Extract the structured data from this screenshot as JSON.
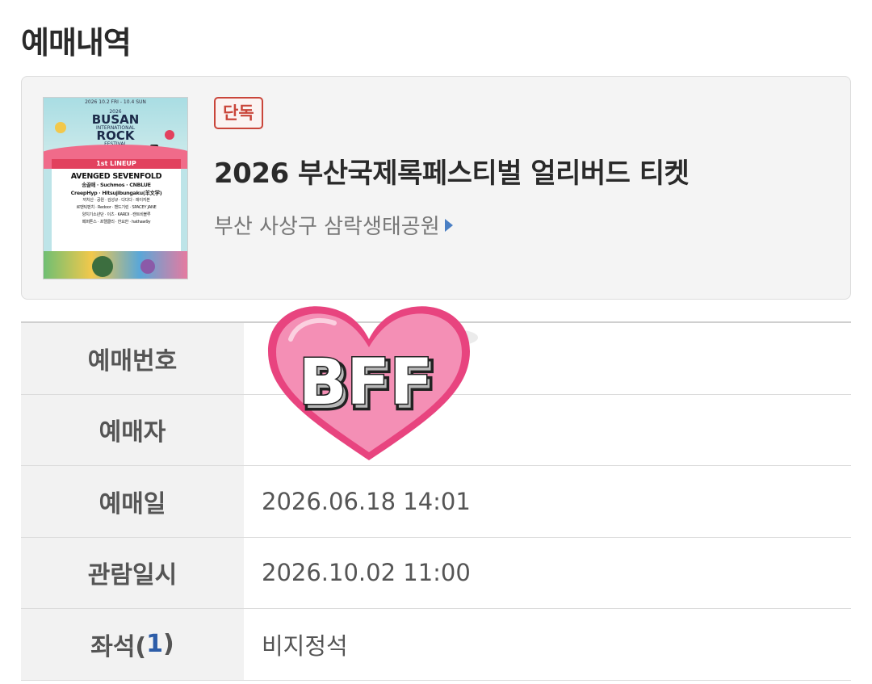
{
  "header": {
    "title": "예매내역"
  },
  "ticket": {
    "badge": "단독",
    "title": "2026 부산국제록페스티벌 얼리버드 티켓",
    "venue": "부산 사상구 삼락생태공원",
    "poster": {
      "date_line": "2026 10.2 FRI - 10.4 SUN",
      "festival_line1": "2026",
      "festival_line2": "BUSAN",
      "festival_line3": "INTERNATIONAL",
      "festival_line4": "ROCK",
      "festival_line5": "FESTIVAL",
      "lineup_label": "1st LINEUP",
      "headliner": "AVENGED SEVENFOLD",
      "lineup_lines": [
        "송골매 · Suchmos · CNBLUE",
        "CreepHyp · Hitsujibungaku(羊文学)",
        "까치산 · 공원 · 김성규 · 다다다 · 레이지본",
        "로맨틱펀치 · Redoor · 밴드기린 · SPACEY JANE",
        "양치기소년단 · 이츠 · KARDI · 캔트비블루",
        "페퍼톤스 · 프렐클리 · 한요한 · hathaw9y"
      ]
    }
  },
  "details": {
    "rows": [
      {
        "label": "예매번호",
        "value": ""
      },
      {
        "label": "예매자",
        "value": ""
      },
      {
        "label": "예매일",
        "value": "2026.06.18 14:01"
      },
      {
        "label": "관람일시",
        "value": "2026.10.02 11:00"
      },
      {
        "label_prefix": "좌석(",
        "label_count": "1",
        "label_suffix": ")",
        "value": "비지정석"
      }
    ]
  },
  "sticker": {
    "text": "BFF",
    "heart_color": "#f48fb5",
    "outline_color": "#e8447f"
  }
}
